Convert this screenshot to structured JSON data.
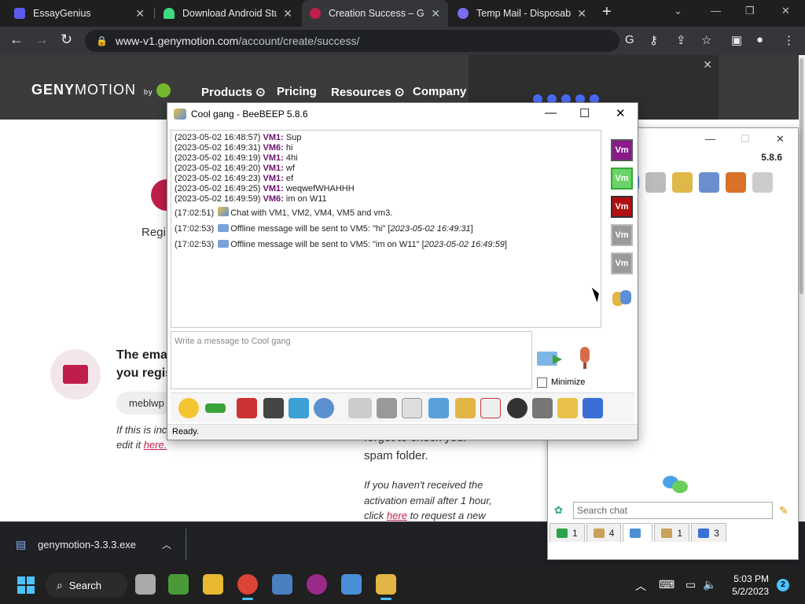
{
  "tabs": [
    {
      "title": "EssayGenius",
      "color": "#5b5bf0"
    },
    {
      "title": "Download Android Stu",
      "color": "#3ddc84"
    },
    {
      "title": "Creation Success – Ge",
      "color": "#c01e4a"
    },
    {
      "title": "Temp Mail - Disposabl",
      "color": "#7b6cf5"
    }
  ],
  "toolbar": {
    "url_host": "www-v1.genymotion.com",
    "url_path": "/account/create/success/"
  },
  "site": {
    "logo_main": "GENY",
    "logo_rest": "MOTION",
    "logo_by": "by",
    "nav": [
      "Products",
      "Pricing",
      "Resources",
      "Company"
    ],
    "regi": "Regi",
    "email_line1": "The ema",
    "email_line2": "you regis",
    "email_pill": "meblwp",
    "incorrect_line1": "If this is inc",
    "incorrect_line2": "edit it",
    "incorrect_link": "here.",
    "spam_line1": "forget to check your",
    "spam_line2": "spam folder.",
    "resend_line1": "If you haven't received the",
    "resend_line2": "activation email after 1 hour,",
    "resend_line3_pre": "click",
    "resend_link": "here",
    "resend_line3_post": "to request a new"
  },
  "download": {
    "filename": "genymotion-3.3.3.exe"
  },
  "taskbar": {
    "search_label": "Search",
    "time": "5:03 PM",
    "date": "5/2/2023",
    "notif_count": "2"
  },
  "beebeep_main": {
    "version": "5.8.6",
    "search_placeholder": "Search chat",
    "tabs": [
      {
        "count": "1",
        "color": "#2aa24a"
      },
      {
        "count": "4",
        "color": "#c9a15a"
      },
      {
        "count": "",
        "color": "#4a90d9"
      },
      {
        "count": "1",
        "color": "#c9a15a"
      },
      {
        "count": "3",
        "color": "#3a6fd6"
      }
    ]
  },
  "chat": {
    "title": "Cool gang - BeeBEEP 5.8.6",
    "messages": [
      {
        "ts": "(2023-05-02 16:48:57)",
        "user": "VM1",
        "text": "Sup"
      },
      {
        "ts": "(2023-05-02 16:49:31)",
        "user": "VM6",
        "text": "hi"
      },
      {
        "ts": "(2023-05-02 16:49:19)",
        "user": "VM1",
        "text": "4hi"
      },
      {
        "ts": "(2023-05-02 16:49:20)",
        "user": "VM1",
        "text": "wf"
      },
      {
        "ts": "(2023-05-02 16:49:23)",
        "user": "VM1",
        "text": "ef"
      },
      {
        "ts": "(2023-05-02 16:49:25)",
        "user": "VM1",
        "text": "weqwefWHAHHH"
      },
      {
        "ts": "(2023-05-02 16:49:59)",
        "user": "VM6",
        "text": "im on W11"
      }
    ],
    "system": [
      {
        "ts": "(17:02:51)",
        "text": "Chat with VM1, VM2, VM4, VM5 and vm3."
      },
      {
        "ts": "(17:02:53)",
        "text": "Offline message will be sent to VM5: \"hi\" [",
        "em": "2023-05-02 16:49:31",
        "end": "]"
      },
      {
        "ts": "(17:02:53)",
        "text": "Offline message will be sent to VM5: \"im on W11\" [",
        "em": "2023-05-02 16:49:59",
        "end": "]"
      }
    ],
    "users": [
      {
        "label": "Vm",
        "color": "#8a1a8a"
      },
      {
        "label": "Vm",
        "color": "#6ad46a"
      },
      {
        "label": "Vm",
        "color": "#b01010"
      },
      {
        "label": "Vm",
        "color": "#9a9a9a"
      },
      {
        "label": "Vm",
        "color": "#9a9a9a"
      }
    ],
    "compose_placeholder": "Write a message to Cool gang",
    "minimize_label": "Minimize",
    "status": "Ready."
  }
}
